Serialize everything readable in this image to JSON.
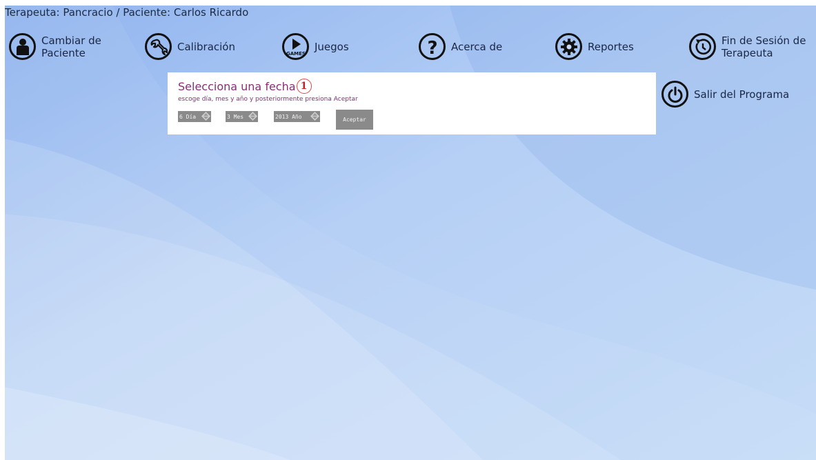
{
  "header": {
    "session_text": "Terapeuta: Pancracio / Paciente: Carlos Ricardo"
  },
  "nav": {
    "change_patient": {
      "label_line1": "Cambiar de",
      "label_line2": "Paciente",
      "icon": "user-icon"
    },
    "calibration": {
      "label": "Calibración",
      "icon": "wrench-icon"
    },
    "games": {
      "label": "Juegos",
      "icon": "games-play-icon",
      "icon_text": "GAMES"
    },
    "about": {
      "label": "Acerca de",
      "icon": "question-icon"
    },
    "reports": {
      "label": "Reportes",
      "icon": "gear-icon"
    },
    "end_session": {
      "label_line1": "Fin de Sesión de",
      "label_line2": "Terapeuta",
      "icon": "restart-icon"
    },
    "exit": {
      "label": "Salir del Programa",
      "icon": "power-icon"
    }
  },
  "date_panel": {
    "title": "Selecciona una fecha",
    "step_badge": "1",
    "instructions": "escoge día, mes y año y posteriormente presiona Aceptar",
    "day_spinner": {
      "value": "6 Día"
    },
    "month_spinner": {
      "value": "3 Mes"
    },
    "year_spinner": {
      "value": "2013 Año"
    },
    "accept_label": "Aceptar"
  },
  "colors": {
    "background": "#a9c8f3",
    "panel_text": "#8b2c7a",
    "badge": "#c02326",
    "control_gray": "#8a8a8a"
  }
}
